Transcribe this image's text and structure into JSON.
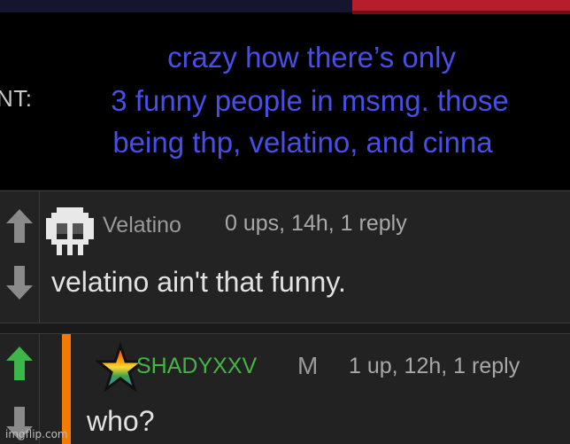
{
  "image_post": {
    "label_prefix": "NT:",
    "quote_lines": [
      "crazy how there’s only",
      "3 funny people in msmg. those",
      "being thp, velatino, and cinna"
    ]
  },
  "comments": [
    {
      "username": "Velatino",
      "meta": "0 ups, 14h, 1 reply",
      "text": "velatino ain't that funny.",
      "upvote_icon": "up-arrow-icon",
      "downvote_icon": "down-arrow-icon",
      "upvoted": false
    },
    {
      "username": "SHADYXXV",
      "badge": "M",
      "meta": "1 up, 12h, 1 reply",
      "text": "who?",
      "upvote_icon": "up-arrow-icon",
      "downvote_icon": "down-arrow-icon",
      "upvoted": true,
      "accent_color": "#f47a00"
    }
  ],
  "watermark": "imgflip.com",
  "colors": {
    "quote_text": "#4a4ee8",
    "upvote_active": "#3cb54a",
    "username_highlight": "#44b544"
  }
}
